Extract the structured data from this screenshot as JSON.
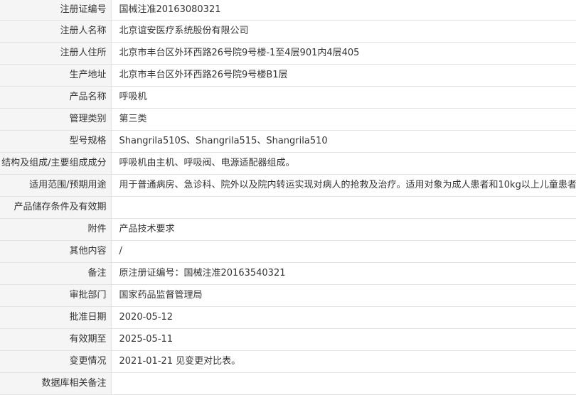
{
  "record": {
    "rows": [
      {
        "label": "注册证编号",
        "value": "国械注准20163080321"
      },
      {
        "label": "注册人名称",
        "value": "北京谊安医疗系统股份有限公司"
      },
      {
        "label": "注册人住所",
        "value": "北京市丰台区外环西路26号院9号楼-1至4层901内4层405"
      },
      {
        "label": "生产地址",
        "value": "北京市丰台区外环西路26号院9号楼B1层"
      },
      {
        "label": "产品名称",
        "value": "呼吸机"
      },
      {
        "label": "管理类别",
        "value": "第三类"
      },
      {
        "label": "型号规格",
        "value": "Shangrila510S、Shangrila515、Shangrila510"
      },
      {
        "label": "结构及组成/主要组成成分",
        "value": "呼吸机由主机、呼吸阀、电源适配器组成。"
      },
      {
        "label": "适用范围/预期用途",
        "value": "用于普通病房、急诊科、院外以及院内转运实现对病人的抢救及治疗。适用对象为成人患者和10kg以上儿童患者。"
      },
      {
        "label": "产品储存条件及有效期",
        "value": ""
      },
      {
        "label": "附件",
        "value": "产品技术要求"
      },
      {
        "label": "其他内容",
        "value": "/"
      },
      {
        "label": "备注",
        "value": "原注册证编号：国械注准20163540321"
      },
      {
        "label": "审批部门",
        "value": "国家药品监督管理局"
      },
      {
        "label": "批准日期",
        "value": "2020-05-12"
      },
      {
        "label": "有效期至",
        "value": "2025-05-11"
      },
      {
        "label": "变更情况",
        "value": "2021-01-21 见变更对比表。"
      },
      {
        "label": "数据库相关备注",
        "value": ""
      }
    ]
  }
}
